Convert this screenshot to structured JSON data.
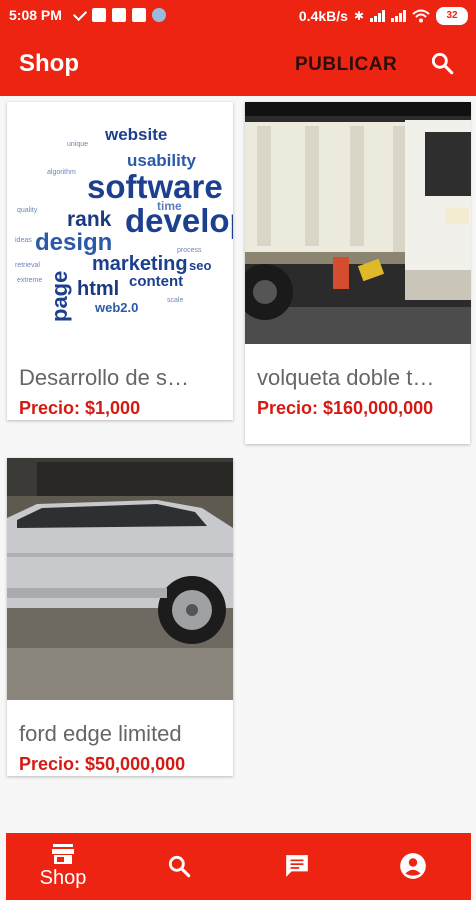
{
  "status_bar": {
    "time": "5:08 PM",
    "speed": "0.4kB/s",
    "battery": "32"
  },
  "app_bar": {
    "title": "Shop",
    "publish_label": "PUBLICAR",
    "search_icon": "search-icon"
  },
  "products": [
    {
      "name": "Desarrollo de s…",
      "price": "Precio: $1,000",
      "image": "software-wordcloud"
    },
    {
      "name": "volqueta doble t…",
      "price": "Precio: $160,000,000",
      "image": "dump-truck-photo"
    },
    {
      "name": "ford edge limited",
      "price": "Precio: $50,000,000",
      "image": "silver-suv-photo"
    }
  ],
  "bottom_nav": {
    "shop_label": "Shop",
    "items": [
      "store-icon",
      "search-icon",
      "chat-icon",
      "account-icon"
    ]
  },
  "colors": {
    "primary": "#ee2413",
    "price": "#d41a12"
  }
}
